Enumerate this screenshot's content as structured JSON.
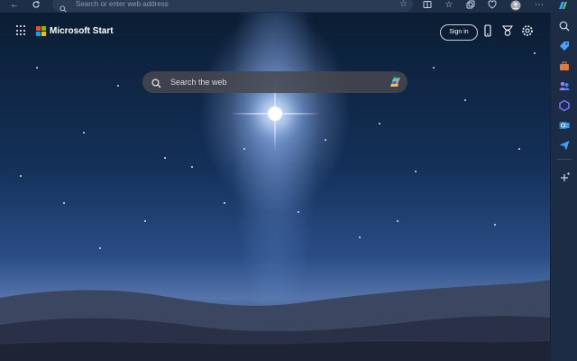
{
  "browser": {
    "address_placeholder": "Search or enter web address",
    "toolbar_icons": [
      "back-icon",
      "refresh-icon",
      "split-screen-icon",
      "favorites-icon",
      "collections-icon",
      "performance-icon",
      "profile-icon",
      "copilot-icon"
    ]
  },
  "page": {
    "brand": "Microsoft Start",
    "signin_label": "Sign in",
    "search_placeholder": "Search the web",
    "header_icons": [
      "phone-icon",
      "rewards-icon",
      "settings-icon"
    ]
  },
  "sidebar": {
    "items": [
      "search-icon",
      "shopping-tag-icon",
      "briefcase-icon",
      "copilot-design-icon",
      "outlook-icon",
      "send-icon",
      "add-icon"
    ]
  },
  "colors": {
    "ms_red": "#f25022",
    "ms_green": "#7fba00",
    "ms_blue": "#00a4ef",
    "ms_yellow": "#ffb900",
    "chrome_bg": "#1c2e48"
  }
}
